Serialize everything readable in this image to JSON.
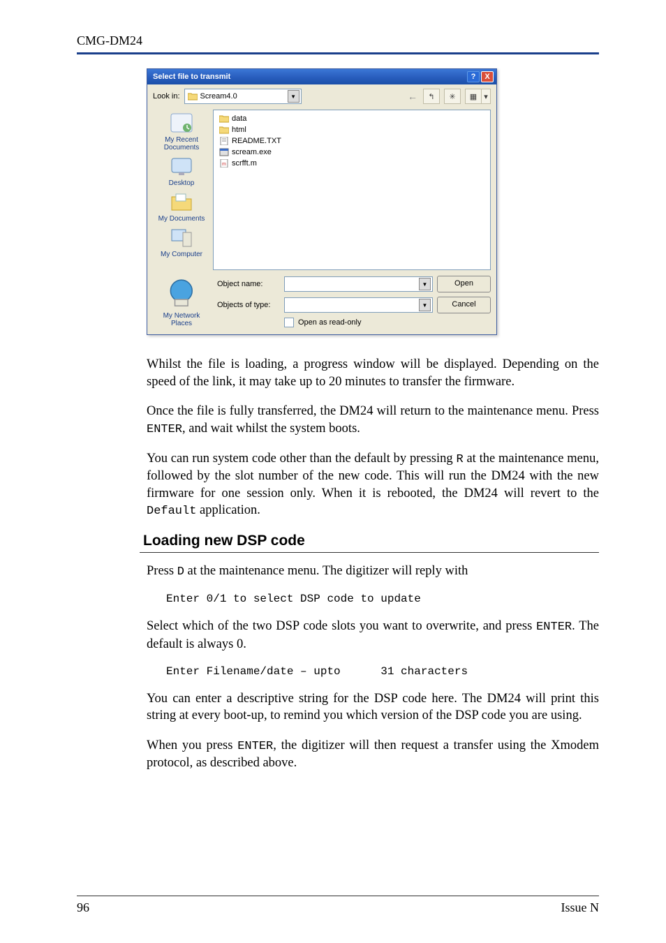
{
  "header": {
    "title": "CMG-DM24"
  },
  "dialog": {
    "title": "Select file to transmit",
    "titlebar": {
      "help_label": "?",
      "close_label": "X"
    },
    "lookin": {
      "label": "Look in:",
      "value": "Scream4.0"
    },
    "nav": {
      "back_label": "←",
      "up_label": "↰",
      "newfolder_label": "✳",
      "views_label": "▦"
    },
    "places": {
      "recent": "My Recent\nDocuments",
      "desktop": "Desktop",
      "mydocs": "My Documents",
      "mycomputer": "My Computer",
      "network": "My Network\nPlaces"
    },
    "files": {
      "items": [
        {
          "name": "data",
          "kind": "folder"
        },
        {
          "name": "html",
          "kind": "folder"
        },
        {
          "name": "README.TXT",
          "kind": "txt"
        },
        {
          "name": "scream.exe",
          "kind": "exe"
        },
        {
          "name": "scrfft.m",
          "kind": "m"
        }
      ]
    },
    "objectname": {
      "label": "Object name:",
      "value": ""
    },
    "objecttype": {
      "label": "Objects of type:",
      "value": ""
    },
    "open_label": "Open",
    "cancel_label": "Cancel",
    "readonly_label": "Open as read-only"
  },
  "body": {
    "p1": "Whilst the file is loading, a progress window will be displayed. Depending on the speed of the link, it may take up to 20 minutes to transfer the firmware.",
    "p2a": "Once the file is fully transferred, the DM24 will return to the maintenance menu. Press ",
    "p2_kbd1": "ENTER",
    "p2b": ", and wait whilst the system boots.",
    "p3a": "You can run system code other than the default by pressing ",
    "p3_kbd1": "R",
    "p3b": " at the maintenance menu, followed by the slot number of the new code. This will run the DM24 with the new firmware for one session only. When it is rebooted, the DM24 will revert to the ",
    "p3_kbd2": "Default",
    "p3c": " application.",
    "section": "Loading new DSP code",
    "p4a": "Press ",
    "p4_kbd1": "D",
    "p4b": " at the maintenance menu. The digitizer will reply with",
    "code1": "Enter 0/1 to select DSP code to update",
    "p5a": "Select which of the two DSP code slots you want to overwrite, and press ",
    "p5_kbd1": "ENTER",
    "p5b": ". The default is always 0.",
    "code2": "Enter Filename/date – upto      31 characters",
    "p6": "You can enter a descriptive string for the DSP code here. The DM24 will print this string at every boot-up, to remind you which version of the DSP code you are using.",
    "p7a": "When you press ",
    "p7_kbd1": "ENTER",
    "p7b": ", the digitizer will then request a transfer using the Xmodem protocol, as described above."
  },
  "footer": {
    "page": "96",
    "issue": "Issue N"
  }
}
